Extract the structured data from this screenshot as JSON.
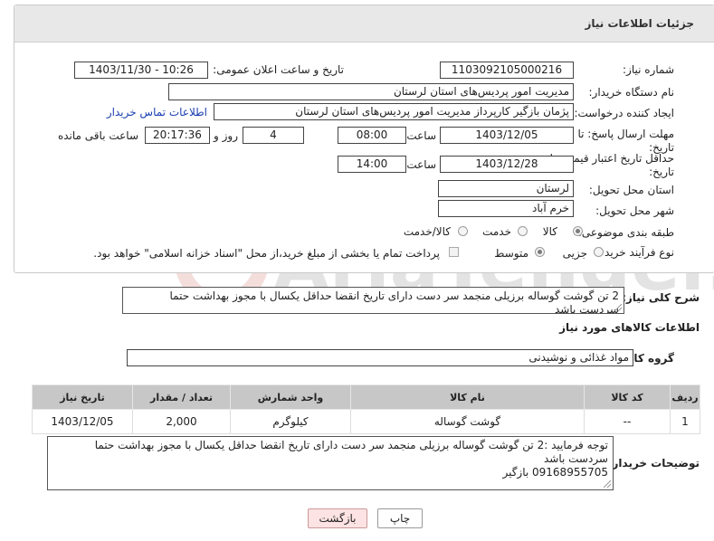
{
  "header": {
    "title": "جزئیات اطلاعات نیاز"
  },
  "fields": {
    "need_number_label": "شماره نیاز:",
    "need_number": "1103092105000216",
    "announce_label": "تاریخ و ساعت اعلان عمومی:",
    "announce_value": "1403/11/30 - 10:26",
    "buyer_label": "نام دستگاه خریدار:",
    "buyer_value": "مدیریت امور پردیس‌های استان لرستان",
    "creator_label": "ایجاد کننده درخواست:",
    "creator_value": "پژمان بازگیر کارپرداز  مدیریت امور پردیس‌های استان لرستان",
    "contact_link": "اطلاعات تماس خریدار",
    "deadline_label": "مهلت ارسال پاسخ: تا تاریخ:",
    "deadline_date": "1403/12/05",
    "time_label": "ساعت",
    "deadline_time": "08:00",
    "days_value": "4",
    "day_and_label": "روز و",
    "remaining_time": "20:17:36",
    "remaining_label": "ساعت باقی مانده",
    "validity_label": "حداقل تاریخ اعتبار قیمت: تا تاریخ:",
    "validity_date": "1403/12/28",
    "validity_time": "14:00",
    "province_label": "استان محل تحویل:",
    "province_value": "لرستان",
    "city_label": "شهر محل تحویل:",
    "city_value": "خرم آباد",
    "category_label": "طبقه بندی موضوعی:",
    "category_goods": "کالا",
    "category_service": "خدمت",
    "category_both": "کالا/خدمت",
    "process_label": "نوع فرآیند خرید :",
    "process_minor": "جزیی",
    "process_medium": "متوسط",
    "payment_note": "پرداخت تمام یا بخشی از مبلغ خرید،از محل \"اسناد خزانه اسلامی\" خواهد بود."
  },
  "description": {
    "label": "شرح کلی نیاز:",
    "text": "2 تن گوشت گوساله  برزیلی  منجمد سر دست دارای تاریخ انقضا حداقل یکسال با مجوز بهداشت  حتما سردست باشد"
  },
  "goods_section": {
    "title": "اطلاعات کالاهای مورد نیاز",
    "group_label": "گروه کالا:",
    "group_value": "مواد غذائی و نوشیدنی"
  },
  "table": {
    "headers": [
      "ردیف",
      "کد کالا",
      "نام کالا",
      "واحد شمارش",
      "تعداد / مقدار",
      "تاریخ نیاز"
    ],
    "rows": [
      [
        "1",
        "--",
        "گوشت گوساله",
        "کیلوگرم",
        "2,000",
        "1403/12/05"
      ]
    ]
  },
  "buyer_notes": {
    "label": "توضیحات خریدار:",
    "line1": "توجه فرمایید :2 تن گوشت گوساله  برزیلی  منجمد سر دست دارای تاریخ انقضا حداقل یکسال با مجوز بهداشت  حتما",
    "line2": "سردست باشد",
    "line3": "09168955705 بازگیر"
  },
  "buttons": {
    "print": "چاپ",
    "back": "بازگشت"
  },
  "watermark": {
    "text": "AriaTender.neT"
  }
}
